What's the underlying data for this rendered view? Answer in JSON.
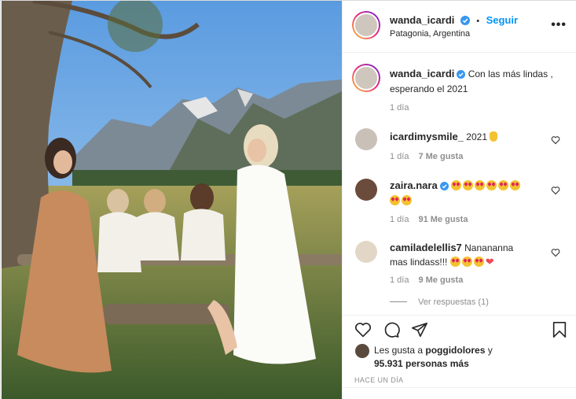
{
  "header": {
    "username": "wanda_icardi",
    "separator": "•",
    "follow_label": "Seguir",
    "location": "Patagonia, Argentina",
    "more_label": "•••"
  },
  "caption": {
    "username": "wanda_icardi",
    "text": "Con las más lindas , esperando el 2021",
    "time": "1 día"
  },
  "comments": [
    {
      "username": "icardimysmile_",
      "text": "2021",
      "time": "1 día",
      "likes": "7 Me gusta"
    },
    {
      "username": "zaira.nara",
      "text": "",
      "emoji_count": 8,
      "time": "1 día",
      "likes": "91 Me gusta"
    },
    {
      "username": "camiladelellis7",
      "text": "Nanananna mas lindass!!!",
      "emoji_count": 3,
      "time": "1 día",
      "likes": "9 Me gusta"
    }
  ],
  "view_replies": "Ver respuestas (1)",
  "likes": {
    "prefix": "Les gusta a ",
    "user": "poggidolores",
    "suffix": " y",
    "count_text": "95.931 personas más"
  },
  "posted": "HACE UN DÍA",
  "colors": {
    "accent": "#0095f6",
    "verified": "#3897f0",
    "muted": "#8e8e8e"
  },
  "icons": [
    "verified-badge-icon",
    "more-options-icon",
    "heart-icon",
    "comment-icon",
    "share-icon",
    "bookmark-icon",
    "waving-hand-icon",
    "heart-eyes-emoji-icon",
    "red-heart-icon"
  ]
}
